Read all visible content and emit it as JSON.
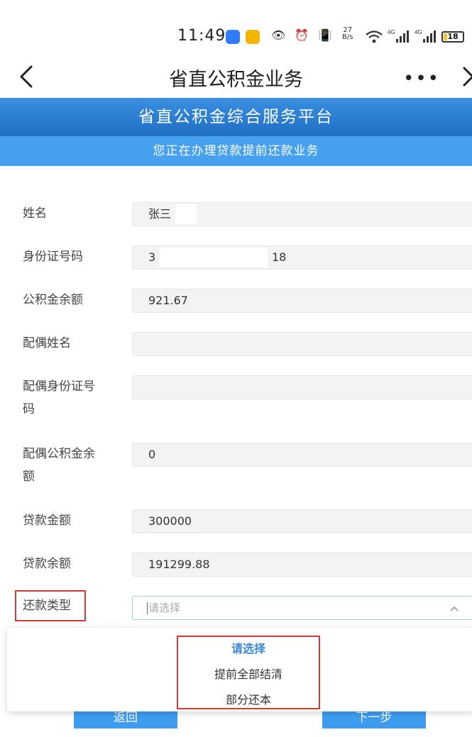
{
  "status_bar": {
    "time": "11:49",
    "net_speed_value": "27",
    "net_speed_unit": "B/s",
    "battery": "18",
    "battery_fraction": 0.18,
    "glyphs": "👁 ⏰ 📳"
  },
  "navbar": {
    "title": "省直公积金业务",
    "more_label": "•••"
  },
  "banner": {
    "title": "省直公积金综合服务平台",
    "subtitle": "您正在办理贷款提前还款业务"
  },
  "form": {
    "name": {
      "label": "姓名",
      "value": "张三"
    },
    "id_number": {
      "label": "身份证号码",
      "value_prefix": "3",
      "value_suffix": "18"
    },
    "fund_balance": {
      "label": "公积金余额",
      "value": "921.67"
    },
    "spouse_name": {
      "label": "配偶姓名",
      "value": ""
    },
    "spouse_id": {
      "label_line1": "配偶身份证号",
      "label_line2": "码",
      "value": ""
    },
    "spouse_fund_balance": {
      "label_line1": "配偶公积金余",
      "label_line2": "额",
      "value": "0"
    },
    "loan_amount": {
      "label": "贷款金额",
      "value": "300000"
    },
    "loan_balance": {
      "label": "贷款余额",
      "value": "191299.88"
    },
    "repayment_type": {
      "label": "还款类型",
      "placeholder": "请选择"
    }
  },
  "dropdown": {
    "options": [
      "请选择",
      "提前全部结清",
      "部分还本"
    ],
    "selected_index": 0
  },
  "buttons": {
    "back": "返回",
    "next": "下一步"
  },
  "colors": {
    "banner_primary": "#1f6fc4",
    "banner_secondary": "#45a0f0",
    "highlight_border": "#d23a3a",
    "selected_option": "#3a86d6"
  }
}
